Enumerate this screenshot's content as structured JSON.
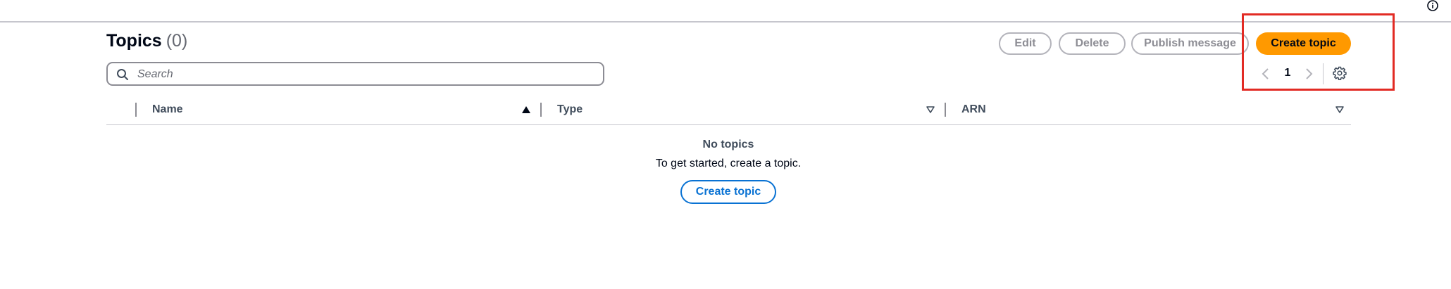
{
  "header": {
    "title": "Topics",
    "count": "(0)",
    "info_icon": "info-icon"
  },
  "actions": {
    "edit_label": "Edit",
    "delete_label": "Delete",
    "publish_label": "Publish message",
    "create_label": "Create topic"
  },
  "search": {
    "placeholder": "Search",
    "value": ""
  },
  "pagination": {
    "current_page": "1",
    "prev_icon": "chevron-left-icon",
    "next_icon": "chevron-right-icon",
    "settings_icon": "gear-icon"
  },
  "table": {
    "columns": [
      {
        "label": "Name",
        "sort": "ascending"
      },
      {
        "label": "Type",
        "sort": "none"
      },
      {
        "label": "ARN",
        "sort": "none"
      }
    ],
    "rows": [],
    "empty": {
      "title": "No topics",
      "description": "To get started, create a topic.",
      "action_label": "Create topic"
    }
  },
  "colors": {
    "primary_button": "#ff9900",
    "link_blue": "#0972d3",
    "highlight": "#e22b24",
    "disabled": "#8d8d94"
  }
}
